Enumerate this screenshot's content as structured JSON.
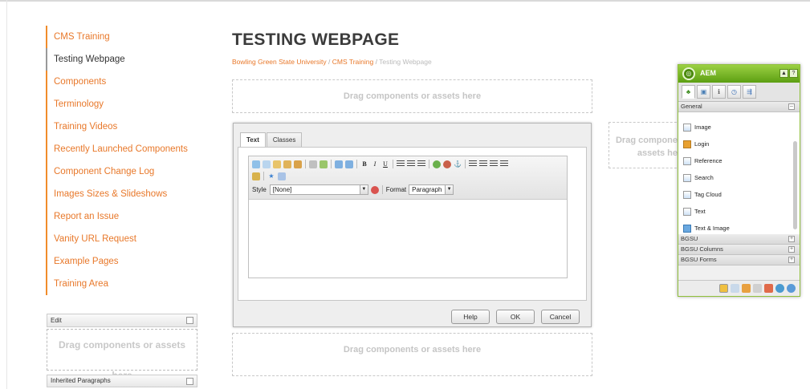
{
  "nav": {
    "items": [
      {
        "label": "CMS Training",
        "active": false
      },
      {
        "label": "Testing Webpage",
        "active": true
      },
      {
        "label": "Components",
        "active": false
      },
      {
        "label": "Terminology",
        "active": false
      },
      {
        "label": "Training Videos",
        "active": false
      },
      {
        "label": "Recently Launched Components",
        "active": false
      },
      {
        "label": "Component Change Log",
        "active": false
      },
      {
        "label": "Images Sizes & Slideshows",
        "active": false
      },
      {
        "label": "Report an Issue",
        "active": false
      },
      {
        "label": "Vanity URL Request",
        "active": false
      },
      {
        "label": "Example Pages",
        "active": false
      },
      {
        "label": "Training Area",
        "active": false
      }
    ]
  },
  "left_parsys": {
    "edit_label": "Edit",
    "drop_text": "Drag components or assets here",
    "inherited_label": "Inherited Paragraphs"
  },
  "page": {
    "title": "TESTING WEBPAGE",
    "breadcrumb": [
      "Bowling Green State University",
      "CMS Training",
      "Testing Webpage"
    ],
    "breadcrumb_sep": " / ",
    "drop_text": "Drag components or assets here",
    "side_drop_text": "Drag compone assets he"
  },
  "dialog": {
    "tabs": [
      "Text",
      "Classes"
    ],
    "style_label": "Style",
    "style_value": "[None]",
    "format_label": "Format",
    "format_value": "Paragraph",
    "buttons": {
      "help": "Help",
      "ok": "OK",
      "cancel": "Cancel"
    }
  },
  "sidekick": {
    "title": "AEM",
    "group_general": "General",
    "components": [
      "Image",
      "Login",
      "Reference",
      "Search",
      "Tag Cloud",
      "Text",
      "Text & Image"
    ],
    "groups": [
      "BGSU",
      "BGSU Columns",
      "BGSU Forms"
    ],
    "colors": {
      "header": "#6aaa1c",
      "accent": "#f08c2b"
    }
  }
}
